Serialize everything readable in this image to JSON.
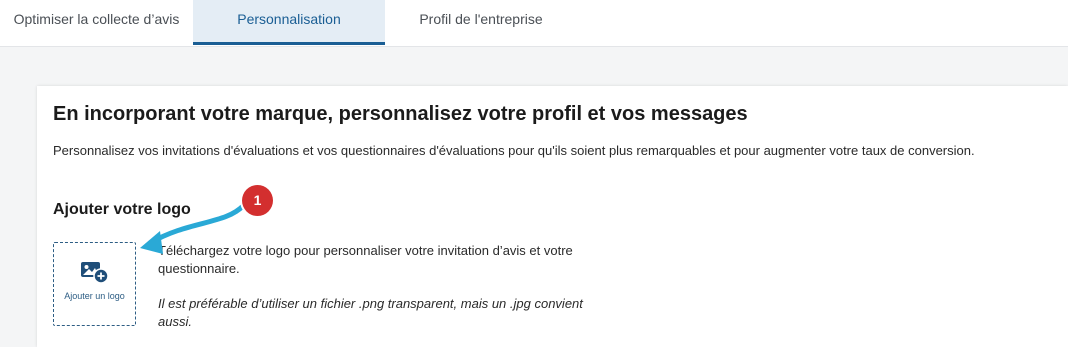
{
  "tabs": [
    {
      "label": "Optimiser la collecte d’avis",
      "active": false
    },
    {
      "label": "Personnalisation",
      "active": true
    },
    {
      "label": "Profil de l'entreprise",
      "active": false
    }
  ],
  "card": {
    "title": "En incorporant votre marque, personnalisez votre profil et vos messages",
    "description": "Personnalisez vos invitations d'évaluations et vos questionnaires d'évaluations pour qu'ils soient plus remarquables et pour augmenter votre taux de conversion.",
    "logo_section": {
      "title": "Ajouter votre logo",
      "button_label": "Ajouter un logo",
      "button_icon": "add-image-icon",
      "upload_text": "Téléchargez votre logo pour personnaliser votre invitation d’avis et votre questionnaire.",
      "note": "Il est préférable d’utiliser un fichier .png transparent, mais un .jpg convient aussi."
    }
  },
  "annotation": {
    "step_number": "1",
    "arrow_icon": "arrow-icon"
  },
  "colors": {
    "accent": "#1a5e94",
    "active_tab_bg": "#e4edf5",
    "badge": "#d32f2f",
    "arrow": "#2aa9d6"
  }
}
